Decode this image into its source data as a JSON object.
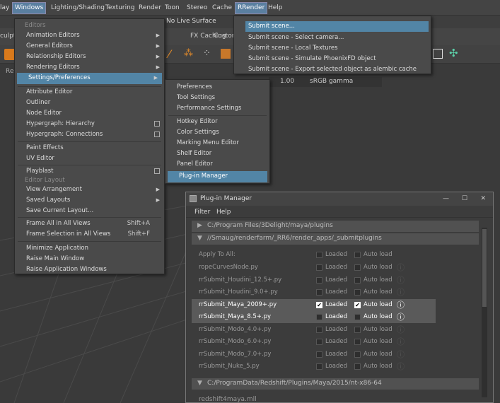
{
  "menubar": {
    "items": [
      "lay",
      "Windows",
      "Lighting/Shading",
      "Texturing",
      "Render",
      "Toon",
      "Stereo",
      "Cache",
      "RRender",
      "Help"
    ]
  },
  "toolbar": {
    "no_live_surface": "No Live Surface",
    "fx_caching": "FX Caching",
    "custom": "Custom",
    "sculpt": "culpt",
    "gamma_value": "1.00",
    "color_space": "sRGB gamma",
    "re_label": "Re"
  },
  "windows_menu": {
    "items": [
      {
        "label": "Editors",
        "type": "header"
      },
      {
        "label": "Animation Editors",
        "type": "sub"
      },
      {
        "label": "General Editors",
        "type": "sub"
      },
      {
        "label": "Relationship Editors",
        "type": "sub"
      },
      {
        "label": "Rendering Editors",
        "type": "sub"
      },
      {
        "label": "Settings/Preferences",
        "type": "sub-selected"
      },
      {
        "label": "Attribute Editor",
        "type": "item"
      },
      {
        "label": "Outliner",
        "type": "item"
      },
      {
        "label": "Node Editor",
        "type": "item"
      },
      {
        "label": "Hypergraph: Hierarchy",
        "type": "check"
      },
      {
        "label": "Hypergraph: Connections",
        "type": "check"
      },
      {
        "label": "Paint Effects",
        "type": "item"
      },
      {
        "label": "UV Editor",
        "type": "item"
      },
      {
        "label": "Playblast",
        "type": "check"
      },
      {
        "label": "Editor Layout",
        "type": "header"
      },
      {
        "label": "View Arrangement",
        "type": "sub"
      },
      {
        "label": "Saved Layouts",
        "type": "sub"
      },
      {
        "label": "Save Current Layout...",
        "type": "item"
      },
      {
        "label": "Frame All in All Views",
        "type": "shortcut",
        "shortcut": "Shift+A"
      },
      {
        "label": "Frame Selection in All Views",
        "type": "shortcut",
        "shortcut": "Shift+F"
      },
      {
        "label": "Minimize Application",
        "type": "item"
      },
      {
        "label": "Raise Main Window",
        "type": "item"
      },
      {
        "label": "Raise Application Windows",
        "type": "item"
      }
    ]
  },
  "settings_menu": {
    "items": [
      "Preferences",
      "Tool Settings",
      "Performance Settings",
      "Hotkey Editor",
      "Color Settings",
      "Marking Menu Editor",
      "Shelf Editor",
      "Panel Editor",
      "Plug-in Manager"
    ]
  },
  "rrender_menu": {
    "items": [
      "Submit scene...",
      "Submit scene - Select camera...",
      "Submit scene - Local Textures",
      "Submit scene - Simulate PhoenixFD object",
      "Submit scene - Export selected object as alembic cache"
    ]
  },
  "plugin_manager": {
    "title": "Plug-in Manager",
    "menu": [
      "Filter",
      "Help"
    ],
    "folders": [
      "C:/Program Files/3Delight/maya/plugins",
      "//Smaug/renderfarm/_RR6/render_apps/_submitplugins",
      "C:/ProgramData/Redshift/Plugins/Maya/2015/nt-x86-64"
    ],
    "apply_to_all": "Apply To All:",
    "loaded_label": "Loaded",
    "autoload_label": "Auto load",
    "plugins": [
      {
        "name": "ropeCurvesNode.py",
        "loaded": false,
        "autoload": false,
        "highlight": false
      },
      {
        "name": "rrSubmit_Houdini_12.5+.py",
        "loaded": false,
        "autoload": false,
        "highlight": false
      },
      {
        "name": "rrSubmit_Houdini_9.0+.py",
        "loaded": false,
        "autoload": false,
        "highlight": false
      },
      {
        "name": "rrSubmit_Maya_2009+.py",
        "loaded": true,
        "autoload": true,
        "highlight": true
      },
      {
        "name": "rrSubmit_Maya_8.5+.py",
        "loaded": false,
        "autoload": false,
        "highlight": true
      },
      {
        "name": "rrSubmit_Modo_4.0+.py",
        "loaded": false,
        "autoload": false,
        "highlight": false
      },
      {
        "name": "rrSubmit_Modo_6.0+.py",
        "loaded": false,
        "autoload": false,
        "highlight": false
      },
      {
        "name": "rrSubmit_Modo_7.0+.py",
        "loaded": false,
        "autoload": false,
        "highlight": false
      },
      {
        "name": "rrSubmit_Nuke_5.py",
        "loaded": false,
        "autoload": false,
        "highlight": false
      }
    ],
    "partial_item": "redshift4maya.mll"
  }
}
